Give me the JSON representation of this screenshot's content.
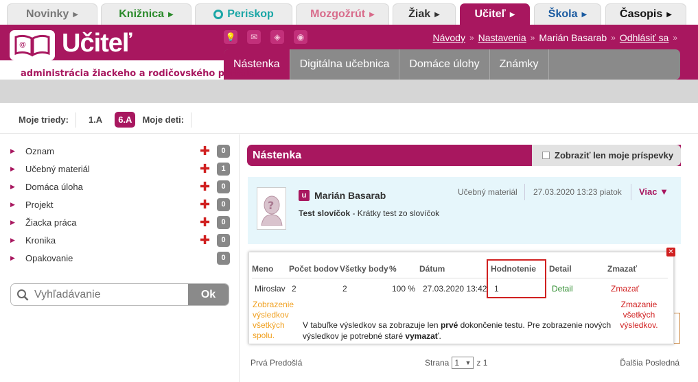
{
  "portal_tabs": [
    {
      "label": "Novinky",
      "color": "#777777"
    },
    {
      "label": "Knižnica",
      "color": "#2a8a2a"
    },
    {
      "label": "Periskop",
      "color": "#1aa6a6"
    },
    {
      "label": "Mozgožrút",
      "color": "#d86a8a"
    },
    {
      "label": "Žiak",
      "color": "#333333"
    },
    {
      "label": "Učiteľ",
      "color": "#ffffff"
    },
    {
      "label": "Škola",
      "color": "#1a5aa0"
    },
    {
      "label": "Časopis",
      "color": "#111111"
    }
  ],
  "header": {
    "title": "Učiteľ",
    "tagline": "administrácia žiackeho a rodičovského portálu",
    "top_links": {
      "navody": "Návody",
      "nastavenia": "Nastavenia",
      "user": "Marián Basarab",
      "logout": "Odhlásiť sa"
    },
    "main_tabs": [
      "Nástenka",
      "Digitálna učebnica",
      "Domáce úlohy",
      "Známky"
    ]
  },
  "classes": {
    "label": "Moje triedy:",
    "items": [
      "1.A",
      "6.A"
    ],
    "active": "6.A",
    "kids_label": "Moje deti:"
  },
  "sidebar": {
    "items": [
      {
        "label": "Oznam",
        "count": "0",
        "plus": true
      },
      {
        "label": "Učebný materiál",
        "count": "1",
        "plus": true
      },
      {
        "label": "Domáca úloha",
        "count": "0",
        "plus": true
      },
      {
        "label": "Projekt",
        "count": "0",
        "plus": true
      },
      {
        "label": "Žiacka práca",
        "count": "0",
        "plus": true
      },
      {
        "label": "Kronika",
        "count": "0",
        "plus": true
      },
      {
        "label": "Opakovanie",
        "count": "0",
        "plus": false
      }
    ]
  },
  "search": {
    "placeholder": "Vyhľadávanie",
    "button": "Ok"
  },
  "board": {
    "title": "Nástenka",
    "filter_label": "Zobraziť len moje príspevky",
    "post": {
      "badge": "u",
      "author": "Marián Basarab",
      "type": "Učebný materiál",
      "date": "27.03.2020 13:23 piatok",
      "more": "Viac",
      "title": "Test slovíčok",
      "desc": " - Krátky test zo slovíčok"
    }
  },
  "results": {
    "headers": {
      "name": "Meno",
      "points": "Počet bodov",
      "total": "Všetky body",
      "pct": "%",
      "date": "Dátum",
      "grade": "Hodnotenie",
      "detail": "Detail",
      "delete": "Zmazať"
    },
    "row": {
      "name": "Miroslav",
      "points": "2",
      "total": "2",
      "pct": "100 %",
      "date": "27.03.2020 13:42",
      "grade": "1",
      "detail": "Detail",
      "delete": "Zmazať"
    },
    "show_all": "Zobrazenie výsledkov všetkých spolu.",
    "note_1": "V tabuľke výsledkov sa zobrazuje len ",
    "note_bold_1": "prvé",
    "note_2": " dokončenie testu. Pre zobrazenie nových výsledkov je potrebné staré ",
    "note_bold_2": "vymazať",
    "note_3": ".",
    "delete_all": "Zmazanie všetkých výsledkov."
  },
  "pager": {
    "first_prev": "Prvá Predošlá",
    "page_label": "Strana",
    "page": "1",
    "of": "z 1",
    "next_last": "Ďalšia Posledná"
  }
}
